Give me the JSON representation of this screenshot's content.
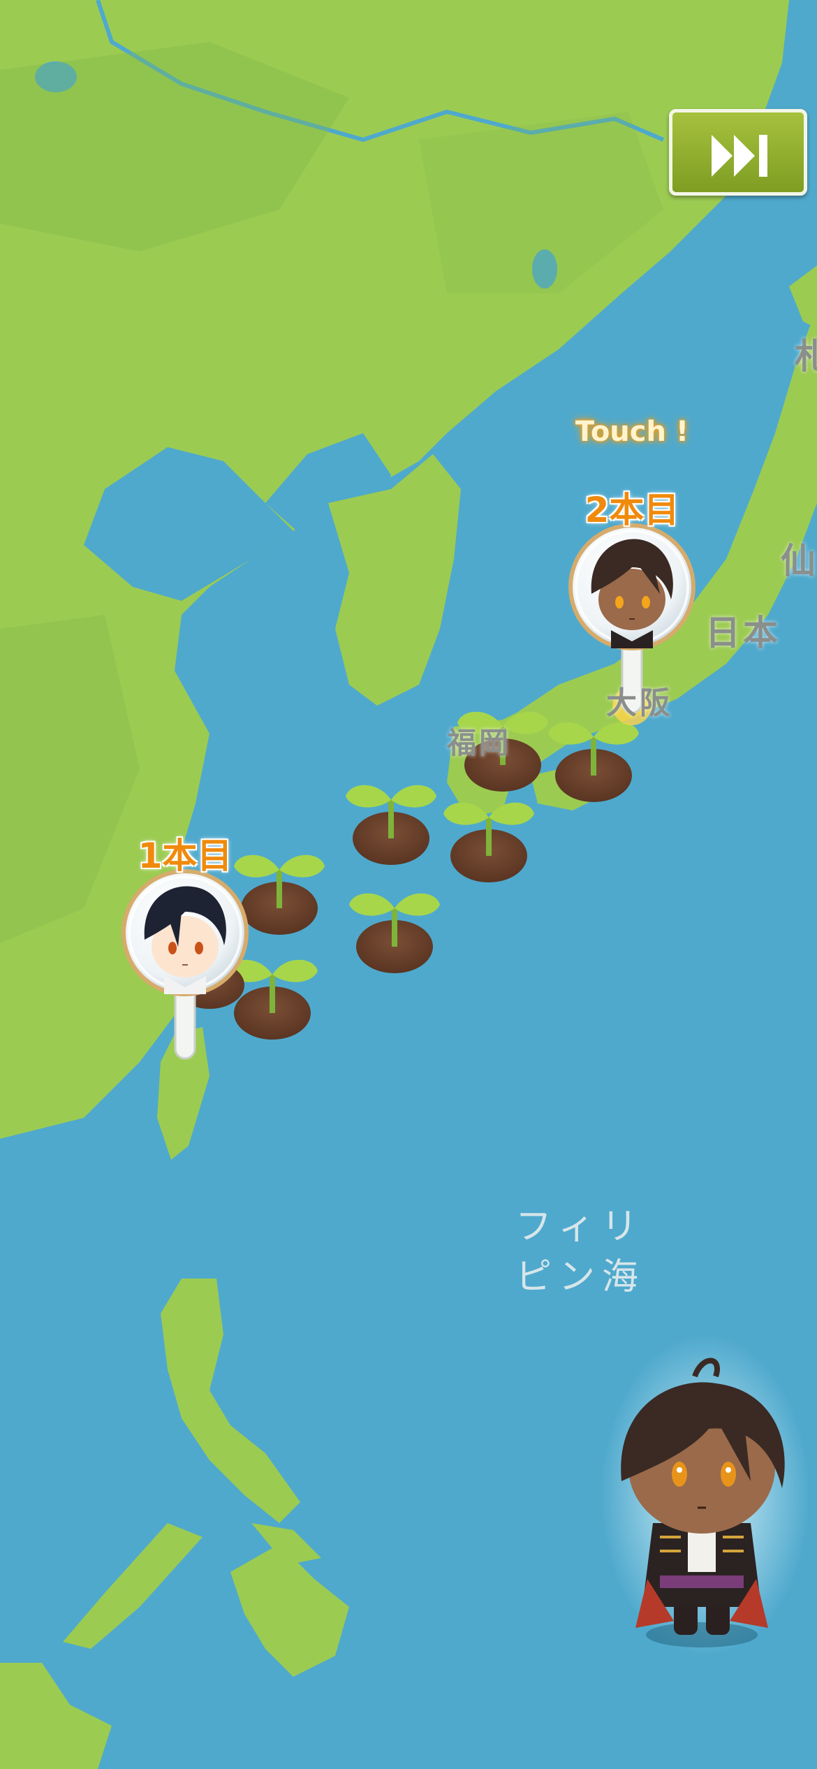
{
  "map": {
    "colors": {
      "sea": "#4fa9cd",
      "land": "#9ccb52",
      "land_dark": "#7fb64a"
    },
    "labels": {
      "sapporo": "札",
      "sendai": "仙",
      "japan": "日本",
      "osaka": "大阪",
      "fukuoka": "福岡",
      "philippine_sea_line1": "フィリ",
      "philippine_sea_line2": "ピン海"
    }
  },
  "skip_button": {
    "icon": "fast-forward-icon",
    "color": "#8fb030"
  },
  "touch_prompt": "Touch !",
  "pins": [
    {
      "count_label": "1本目",
      "character": "dark-haired-chibi-character"
    },
    {
      "count_label": "2本目",
      "character": "brown-haired-chibi-character"
    }
  ],
  "sprouts": {
    "count": 8,
    "icon": "sprout-icon"
  },
  "guide_character": {
    "name": "brown-haired-chibi-guide"
  }
}
